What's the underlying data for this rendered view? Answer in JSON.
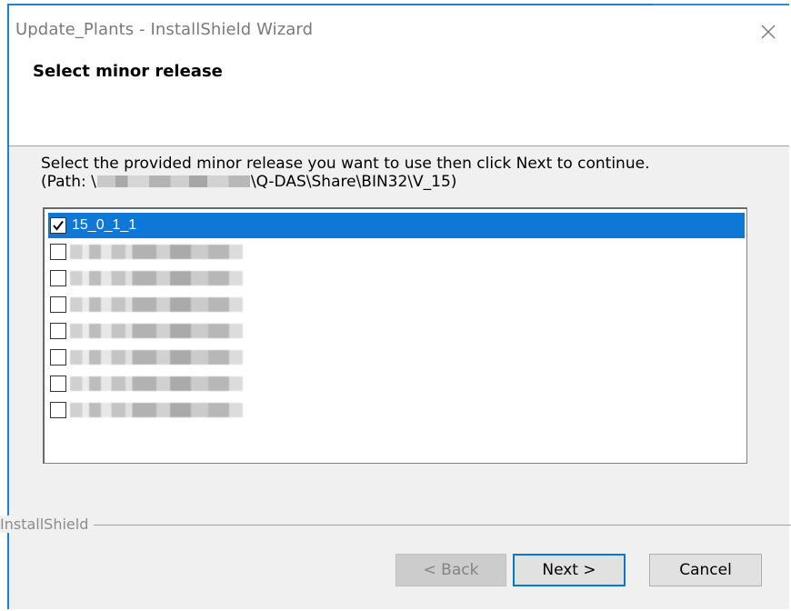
{
  "window": {
    "title": "Update_Plants - InstallShield Wizard"
  },
  "header": {
    "title": "Select minor release"
  },
  "instruction": {
    "line1": "Select the provided minor release you want to use then click Next to continue.",
    "path_prefix": "(Path: \\",
    "path_suffix": "\\Q-DAS\\Share\\BIN32\\V_15)"
  },
  "release_list": {
    "items": [
      {
        "label": "15_0_1_1",
        "checked": true,
        "selected": true
      },
      {
        "label": "",
        "checked": false,
        "selected": false
      },
      {
        "label": "",
        "checked": false,
        "selected": false
      },
      {
        "label": "",
        "checked": false,
        "selected": false
      },
      {
        "label": "",
        "checked": false,
        "selected": false
      },
      {
        "label": "",
        "checked": false,
        "selected": false
      },
      {
        "label": "",
        "checked": false,
        "selected": false
      },
      {
        "label": "",
        "checked": false,
        "selected": false
      }
    ]
  },
  "footer": {
    "brand": "InstallShield"
  },
  "buttons": {
    "back": "< Back",
    "next": "Next >",
    "cancel": "Cancel"
  },
  "colors": {
    "selection": "#0f78d7",
    "accent": "#0078d7"
  },
  "icons": {
    "close": "close-icon",
    "check": "checkmark-icon"
  }
}
